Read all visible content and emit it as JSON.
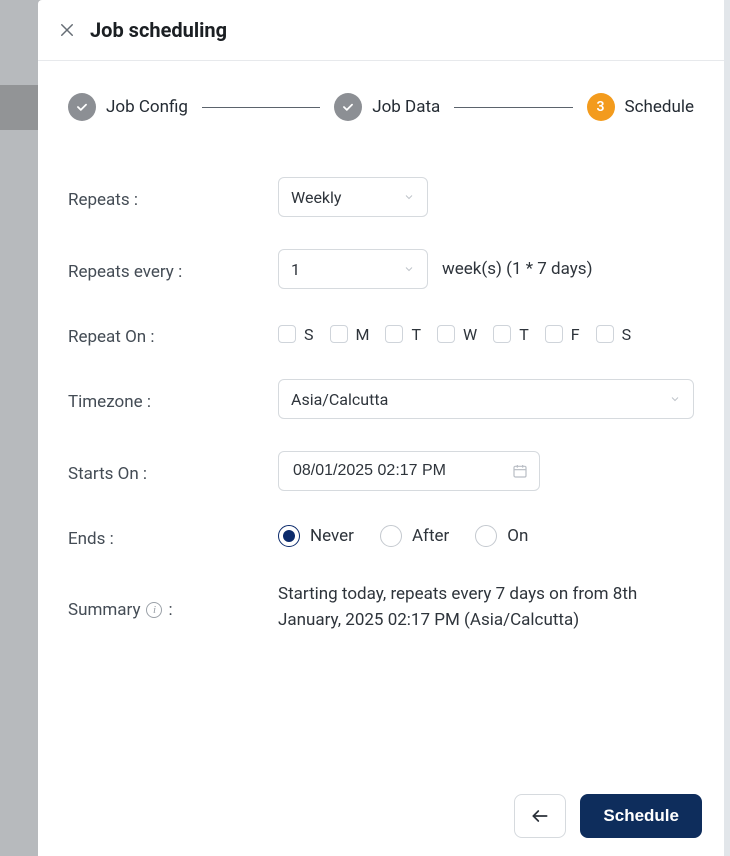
{
  "header": {
    "title": "Job scheduling"
  },
  "stepper": {
    "steps": [
      {
        "label": "Job Config",
        "state": "done"
      },
      {
        "label": "Job Data",
        "state": "done"
      },
      {
        "label": "Schedule",
        "state": "active",
        "number": "3"
      }
    ]
  },
  "form": {
    "repeats": {
      "label": "Repeats :",
      "value": "Weekly"
    },
    "repeats_every": {
      "label": "Repeats every :",
      "value": "1",
      "suffix": "week(s) (1 * 7 days)"
    },
    "repeat_on": {
      "label": "Repeat On :",
      "days": [
        {
          "letter": "S",
          "checked": false
        },
        {
          "letter": "M",
          "checked": false
        },
        {
          "letter": "T",
          "checked": false
        },
        {
          "letter": "W",
          "checked": false
        },
        {
          "letter": "T",
          "checked": false
        },
        {
          "letter": "F",
          "checked": false
        },
        {
          "letter": "S",
          "checked": false
        }
      ]
    },
    "timezone": {
      "label": "Timezone :",
      "value": "Asia/Calcutta"
    },
    "starts_on": {
      "label": "Starts On :",
      "value": "08/01/2025 02:17 PM"
    },
    "ends": {
      "label": "Ends :",
      "options": [
        {
          "label": "Never",
          "selected": true
        },
        {
          "label": "After",
          "selected": false
        },
        {
          "label": "On",
          "selected": false
        }
      ]
    },
    "summary": {
      "label": "Summary",
      "info_suffix": " :",
      "text": "Starting today, repeats every 7 days on from 8th January, 2025 02:17 PM (Asia/Calcutta)"
    }
  },
  "footer": {
    "schedule_label": "Schedule"
  }
}
